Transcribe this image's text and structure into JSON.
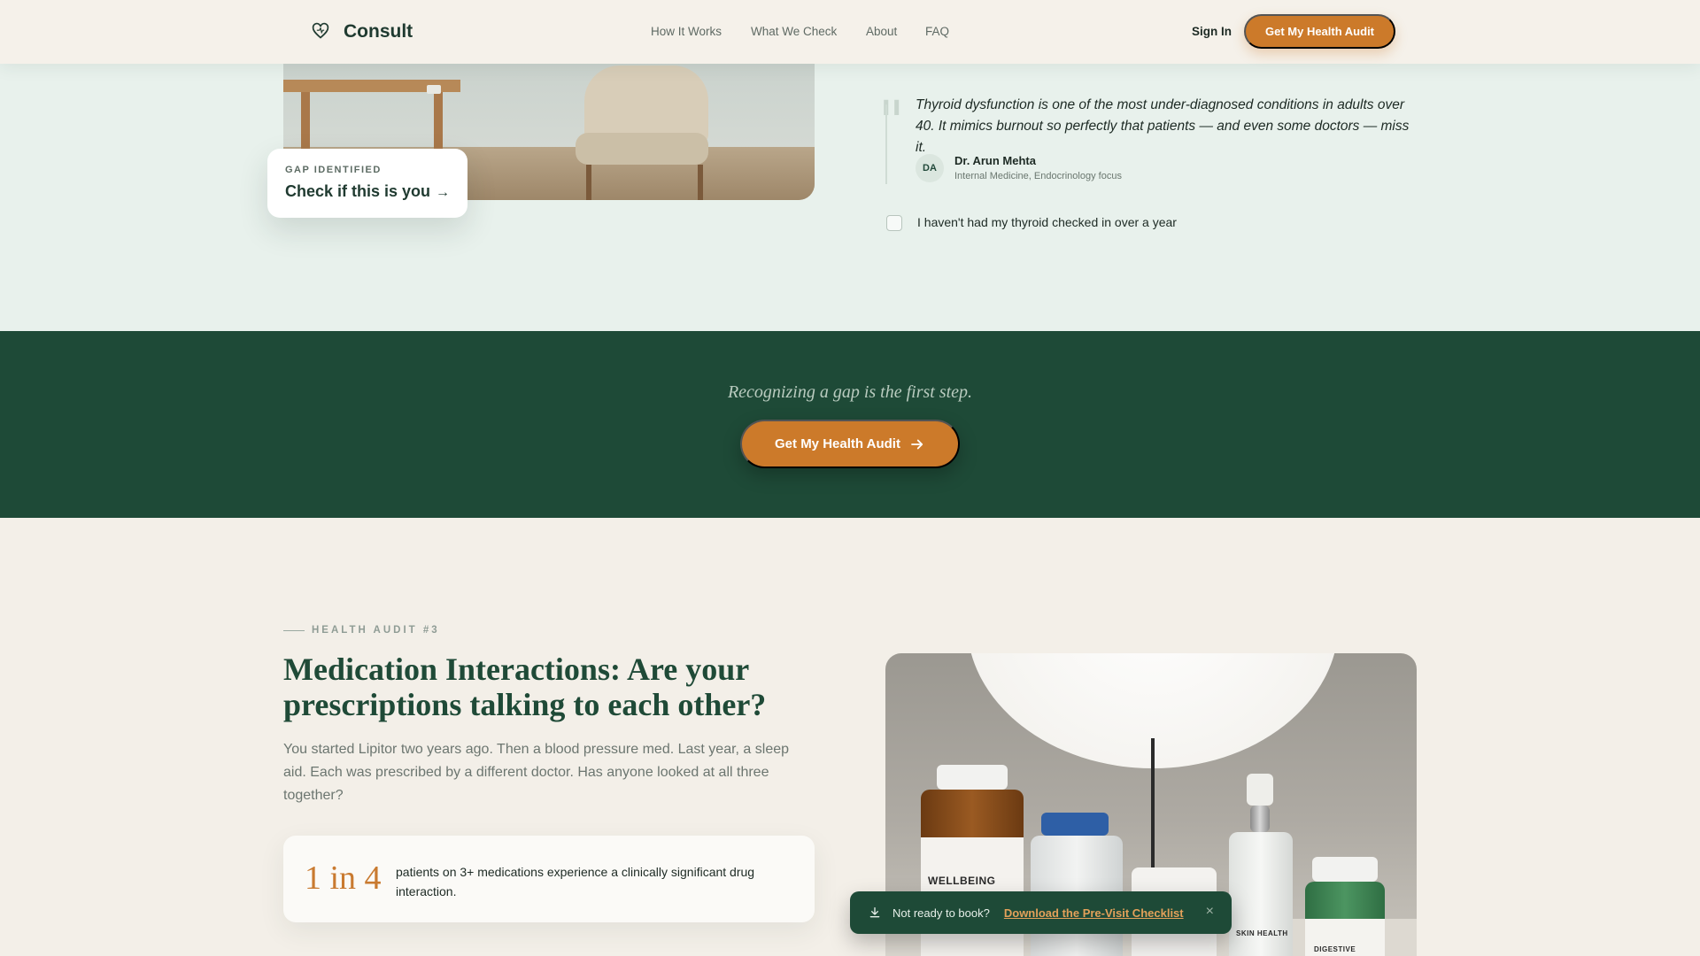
{
  "header": {
    "logo": "Consult",
    "nav": [
      "How It Works",
      "What We Check",
      "About",
      "FAQ"
    ],
    "sign_in": "Sign In",
    "cta": "Get My Health Audit"
  },
  "gap_card": {
    "eyebrow": "GAP IDENTIFIED",
    "title": "Check if this is you",
    "arrow": "→"
  },
  "testimonial": {
    "quote_mark": "\"",
    "quote": "Thyroid dysfunction is one of the most under-diagnosed conditions in adults over 40. It mimics burnout so perfectly that patients — and even some doctors — miss it.",
    "initials": "DA",
    "name": "Dr. Arun Mehta",
    "role": "Internal Medicine, Endocrinology focus"
  },
  "checkbox": {
    "label": "I haven't had my thyroid checked in over a year",
    "checked": false
  },
  "band": {
    "tagline": "Recognizing a gap is the first step.",
    "cta": "Get My Health Audit"
  },
  "audit": {
    "eyebrow": "HEALTH AUDIT #3",
    "title": "Medication Interactions: Are your prescriptions talking to each other?",
    "lead": "You started Lipitor two years ago. Then a blood pressure med. Last year, a sleep aid. Each was prescribed by a different doctor. Has anyone looked at all three together?",
    "stat_number": "1 in 4",
    "stat_text": "patients on 3+ medications experience a clinically significant drug interaction.",
    "photo_labels": [
      "WELLBEING",
      "SKIN HEALTH",
      "DIGESTIVE"
    ]
  },
  "toast": {
    "text": "Not ready to book?",
    "link": "Download the Pre-Visit Checklist",
    "close": "×"
  },
  "colors": {
    "brand_green": "#1e4a37",
    "accent_orange": "#cc7a2a",
    "mint_bg": "#e8f1ec",
    "cream_bg": "#f3efe8"
  },
  "icons": [
    "heart-logo-icon",
    "arrow-right-icon",
    "download-icon",
    "close-icon"
  ]
}
